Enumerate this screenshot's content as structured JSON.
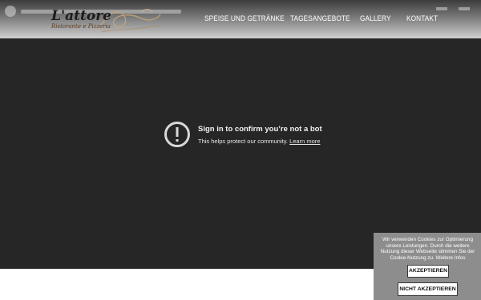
{
  "header": {
    "logo": {
      "name": "L'attore",
      "subtitle": "Ristorante e Pizzeria"
    },
    "nav": [
      {
        "label": "SPEISE UND GETRÄNKE"
      },
      {
        "label": "TAGESANGEBOTE"
      },
      {
        "label": "GALLERY"
      },
      {
        "label": "KONTAKT"
      }
    ]
  },
  "video": {
    "title": "Sign in to confirm you’re not a bot",
    "message": "This helps protect our community.",
    "link": "Learn more",
    "icon": "warning-circle-icon"
  },
  "cookie": {
    "text": "Wir verwenden Cookies zur Optimierung unsere Leistungen. Durch die weitere Nutzung dieser Webseite stimmen Sie der Cookie-Nutzung zu.",
    "info_link": "Weitere Infos",
    "accept_label": "AKZEPTIEREN",
    "decline_label": "NICHT AKZEPTIEREN"
  },
  "colors": {
    "video_bg": "#262626",
    "cookie_bg": "#8d8d8d"
  }
}
